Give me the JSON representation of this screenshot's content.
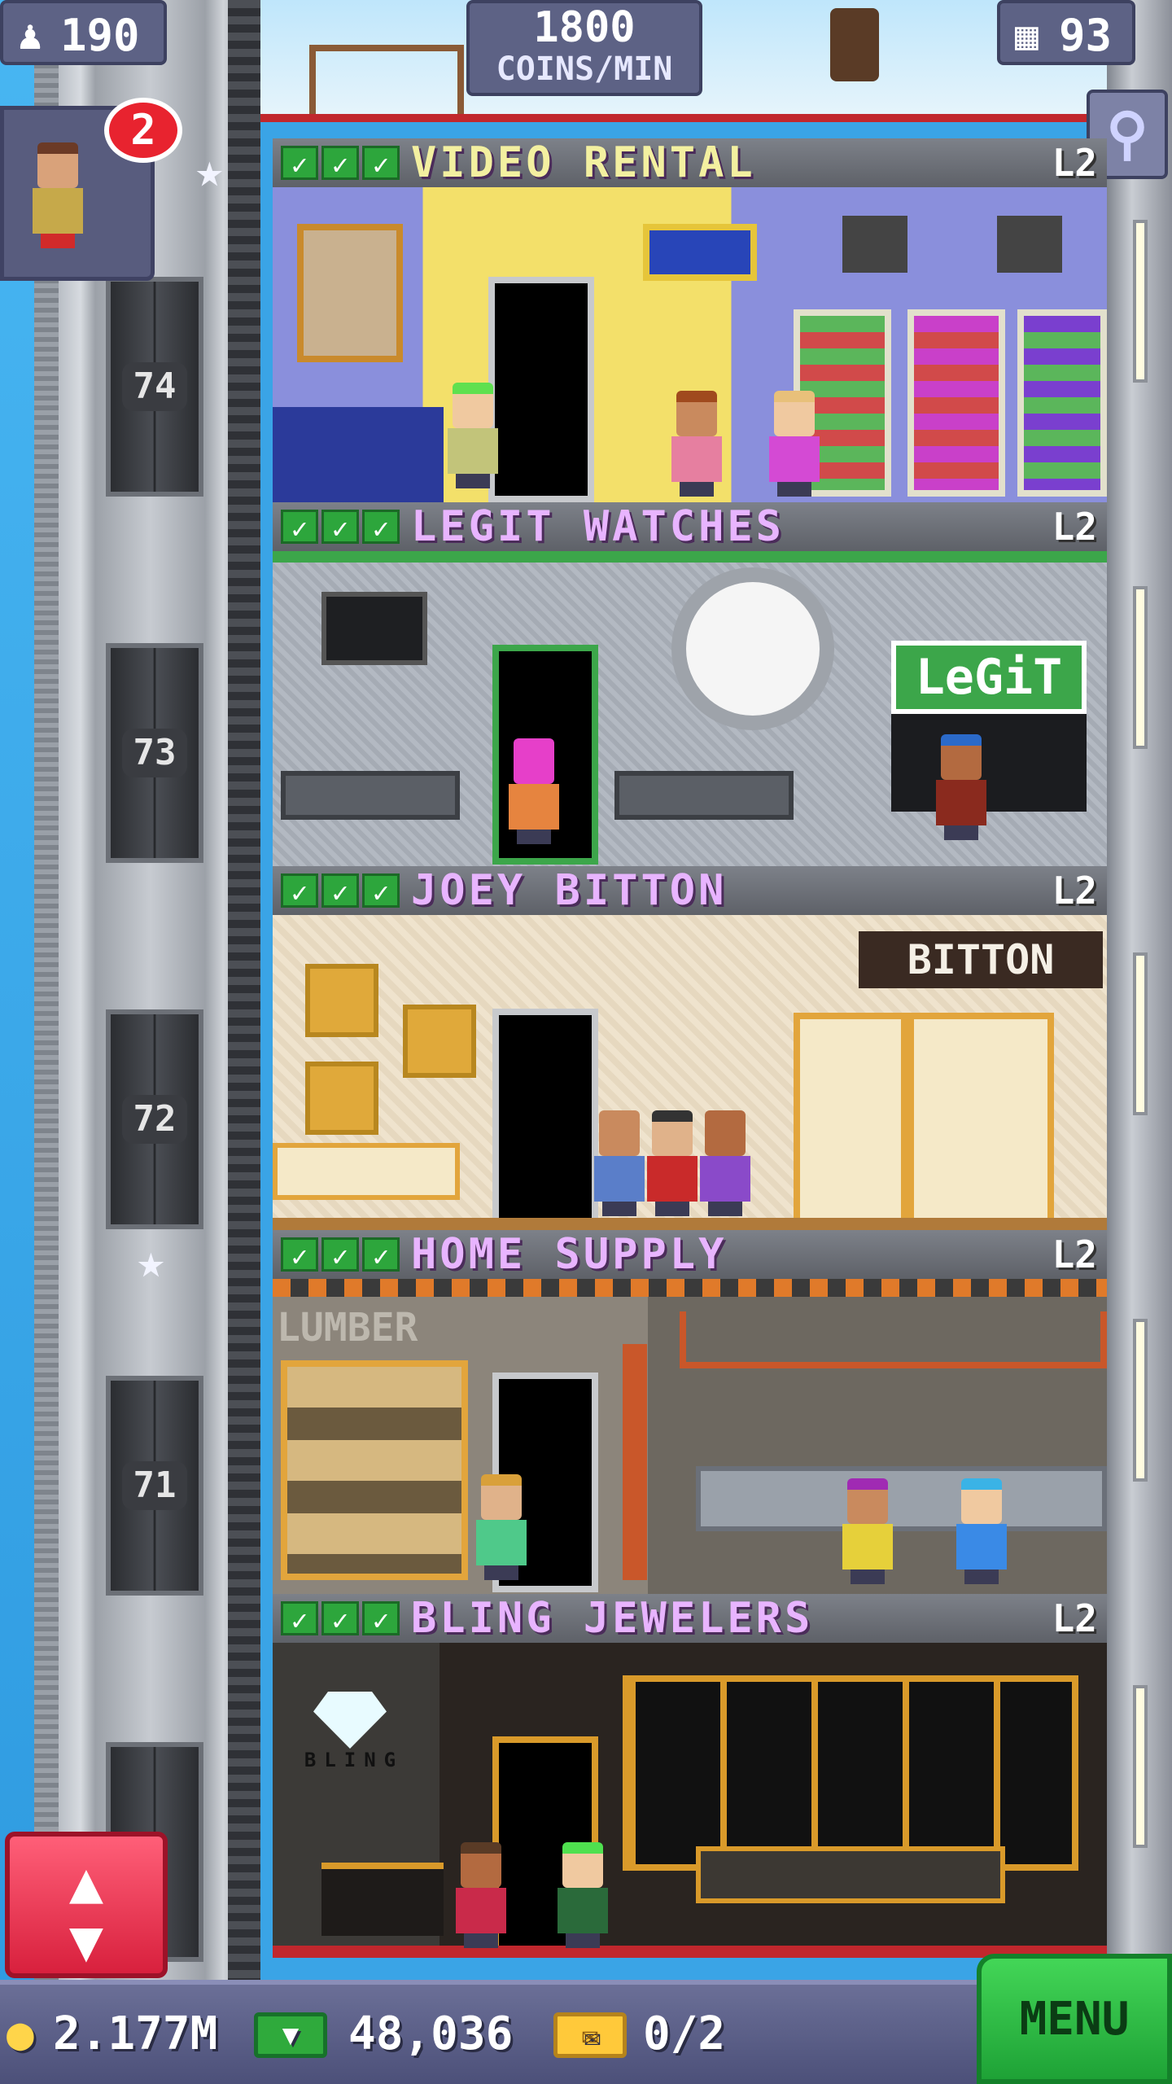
{
  "hud": {
    "population": "190",
    "coins_rate_value": "1800",
    "coins_rate_unit": "COINS/MIN",
    "floors_count": "93",
    "visitor_badge": "2"
  },
  "elevator": {
    "floor_labels": [
      "74",
      "73",
      "72",
      "71"
    ]
  },
  "floors": [
    {
      "name": "VIDEO RENTAL",
      "level": "L2"
    },
    {
      "name": "LEGIT WATCHES",
      "level": "L2"
    },
    {
      "name": "JOEY BITTON",
      "level": "L2"
    },
    {
      "name": "HOME SUPPLY",
      "level": "L2"
    },
    {
      "name": "BLING JEWELERS",
      "level": "L2"
    }
  ],
  "signs": {
    "legit": "LeGiT",
    "bitton": "BITTON",
    "lumber": "LUMBER",
    "bling": "BLING"
  },
  "footer": {
    "coins": "2.177M",
    "bux": "48,036",
    "tickets": "0/2",
    "menu_label": "MENU"
  },
  "colors": {
    "floor_name": "#e8b4ff",
    "check_green": "#2da63c",
    "menu_green": "#2fbd48",
    "updown_red": "#e8364f",
    "badge_red": "#e8232f"
  },
  "icons": [
    "person-icon",
    "coins-icon",
    "building-icon",
    "search-icon",
    "star-icon",
    "coin-icon",
    "bux-icon",
    "ticket-icon",
    "arrows-icon"
  ]
}
